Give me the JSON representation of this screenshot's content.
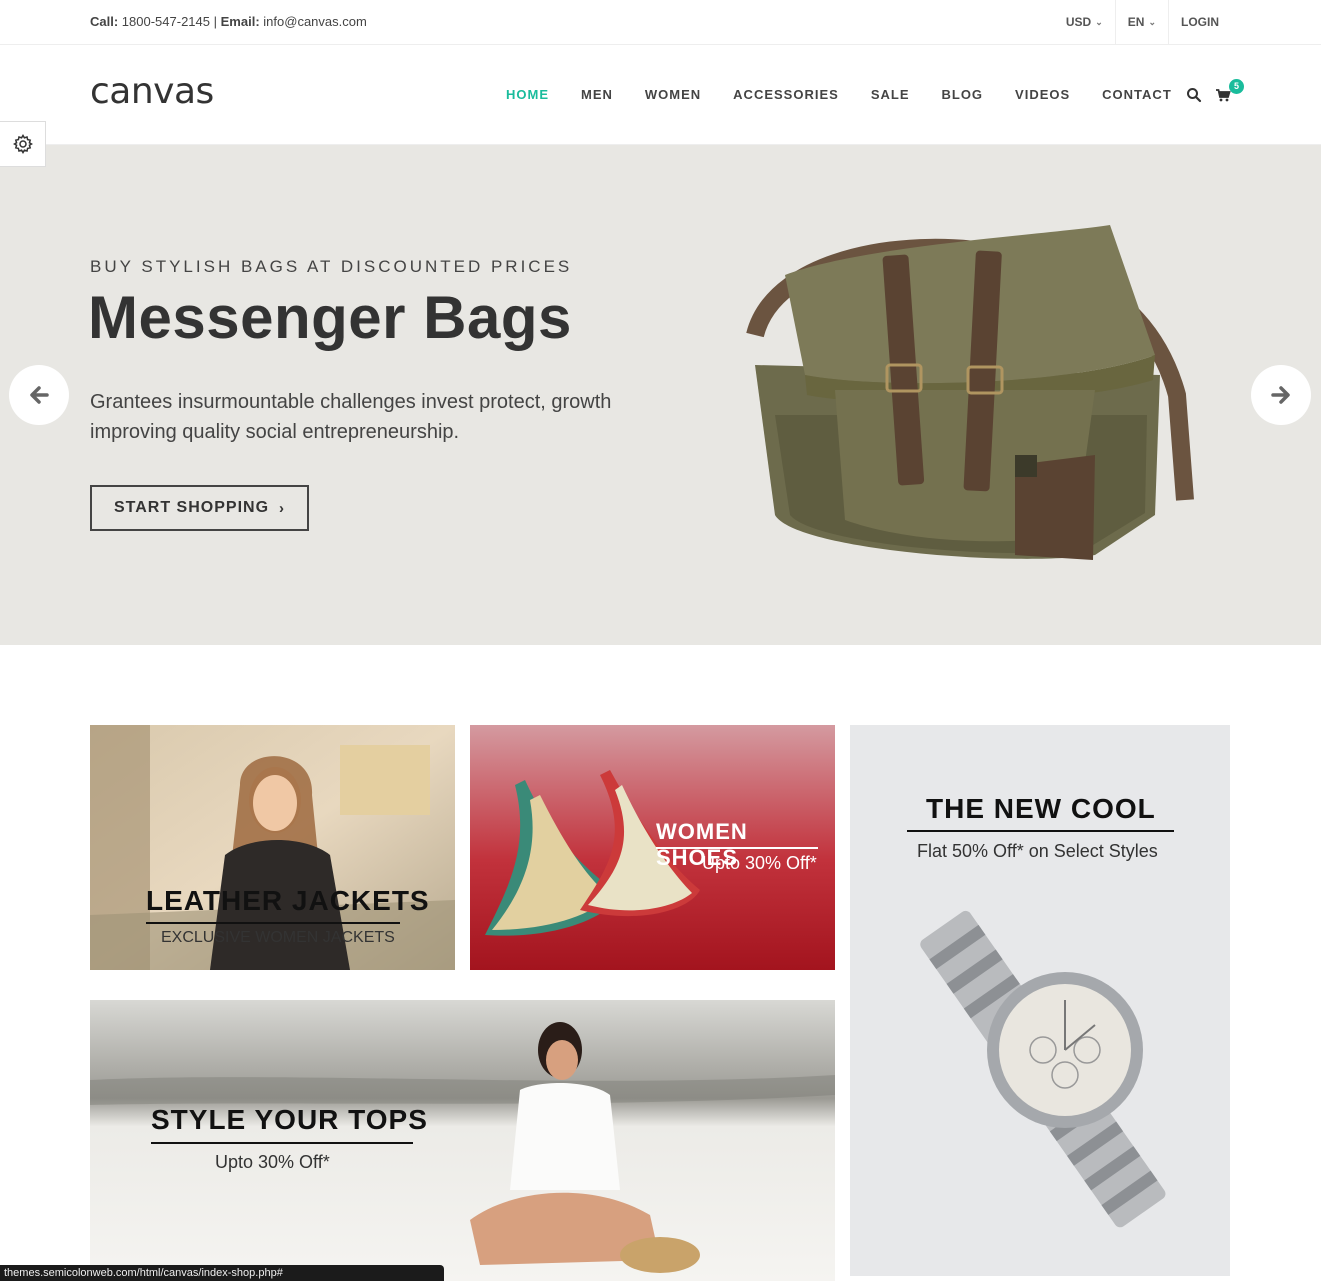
{
  "topbar": {
    "call_label": "Call:",
    "phone": "1800-547-2145",
    "separator": "|",
    "email_label": "Email:",
    "email": "info@canvas.com",
    "currency": "USD",
    "language": "EN",
    "login": "LOGIN"
  },
  "header": {
    "logo": "canvas",
    "nav": [
      "HOME",
      "MEN",
      "WOMEN",
      "ACCESSORIES",
      "SALE",
      "BLOG",
      "VIDEOS",
      "CONTACT"
    ],
    "active_nav": "HOME",
    "cart_count": "5",
    "accent_color": "#1abc9c"
  },
  "hero": {
    "kicker": "BUY STYLISH BAGS AT DISCOUNTED PRICES",
    "title": "Messenger Bags",
    "description": "Grantees insurmountable challenges invest protect, growth improving quality social entrepreneurship.",
    "cta": "START SHOPPING",
    "background": "#e8e7e3"
  },
  "promos": {
    "leather": {
      "title": "LEATHER JACKETS",
      "subtitle": "EXCLUSIVE WOMEN JACKETS"
    },
    "shoes": {
      "title": "WOMEN SHOES",
      "subtitle": "Upto 30% Off*"
    },
    "cool": {
      "title": "THE NEW COOL",
      "subtitle": "Flat 50% Off* on Select Styles"
    },
    "tops": {
      "title": "STYLE YOUR TOPS",
      "subtitle": "Upto 30% Off*"
    }
  },
  "statusbar": {
    "url": "themes.semicolonweb.com/html/canvas/index-shop.php#"
  },
  "icons": [
    "gear-icon",
    "search-icon",
    "cart-icon",
    "arrow-left-icon",
    "arrow-right-icon",
    "chevron-right-icon",
    "chevron-down-icon"
  ]
}
